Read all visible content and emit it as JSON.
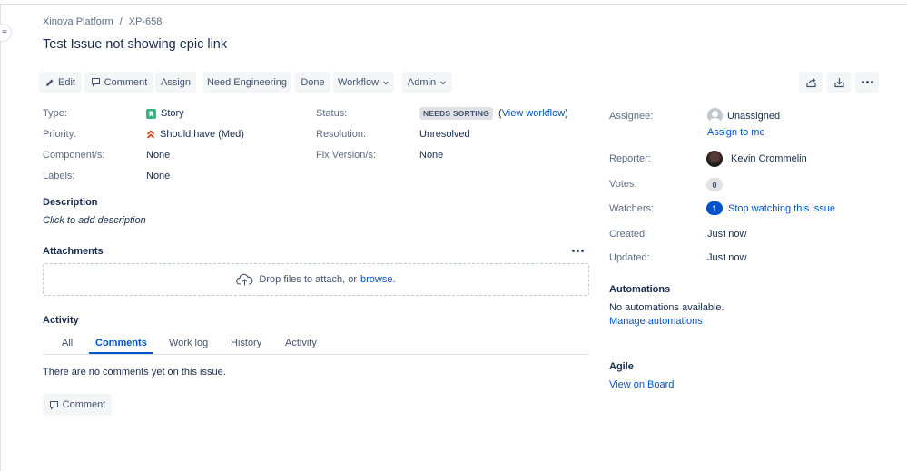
{
  "breadcrumb": {
    "project": "Xinova Platform",
    "separator": "/",
    "issue_key": "XP-658"
  },
  "issue": {
    "title": "Test Issue not showing epic link"
  },
  "toolbar": {
    "edit": "Edit",
    "comment": "Comment",
    "assign": "Assign",
    "need_engineering": "Need Engineering",
    "done": "Done",
    "workflow": "Workflow",
    "admin": "Admin"
  },
  "details": {
    "type_label": "Type:",
    "type_value": "Story",
    "priority_label": "Priority:",
    "priority_value": "Should have (Med)",
    "components_label": "Component/s:",
    "components_value": "None",
    "labels_label": "Labels:",
    "labels_value": "None",
    "status_label": "Status:",
    "status_value": "NEEDS SORTING",
    "view_workflow_open": "(",
    "view_workflow": "View workflow",
    "view_workflow_close": ")",
    "resolution_label": "Resolution:",
    "resolution_value": "Unresolved",
    "fix_version_label": "Fix Version/s:",
    "fix_version_value": "None"
  },
  "description": {
    "heading": "Description",
    "placeholder": "Click to add description"
  },
  "attachments": {
    "heading": "Attachments",
    "drop_text": "Drop files to attach, or",
    "browse": "browse."
  },
  "activity": {
    "heading": "Activity",
    "tabs": [
      "All",
      "Comments",
      "Work log",
      "History",
      "Activity"
    ],
    "active_tab": "Comments",
    "empty_text": "There are no comments yet on this issue.",
    "comment_button": "Comment"
  },
  "people": {
    "assignee_label": "Assignee:",
    "assignee_value": "Unassigned",
    "assign_to_me": "Assign to me",
    "reporter_label": "Reporter:",
    "reporter_value": "Kevin Crommelin",
    "votes_label": "Votes:",
    "votes_count": "0",
    "watchers_label": "Watchers:",
    "watchers_count": "1",
    "stop_watching": "Stop watching this issue"
  },
  "dates": {
    "created_label": "Created:",
    "created_value": "Just now",
    "updated_label": "Updated:",
    "updated_value": "Just now"
  },
  "automations": {
    "heading": "Automations",
    "none_text": "No automations available.",
    "manage_link": "Manage automations"
  },
  "agile": {
    "heading": "Agile",
    "view_board": "View on Board"
  },
  "colors": {
    "link": "#0052cc",
    "story_icon": "#36b37e",
    "priority_icon": "#de350b",
    "lozenge_bg": "#dfe1e6"
  },
  "icons": {
    "edit": "pencil-icon",
    "comment": "speech-bubble-icon",
    "dropdown": "chevron-down-icon",
    "share": "share-icon",
    "export": "export-icon",
    "more": "more-icon",
    "story": "story-icon",
    "priority": "double-chevron-up-icon",
    "upload": "cloud-upload-icon"
  }
}
